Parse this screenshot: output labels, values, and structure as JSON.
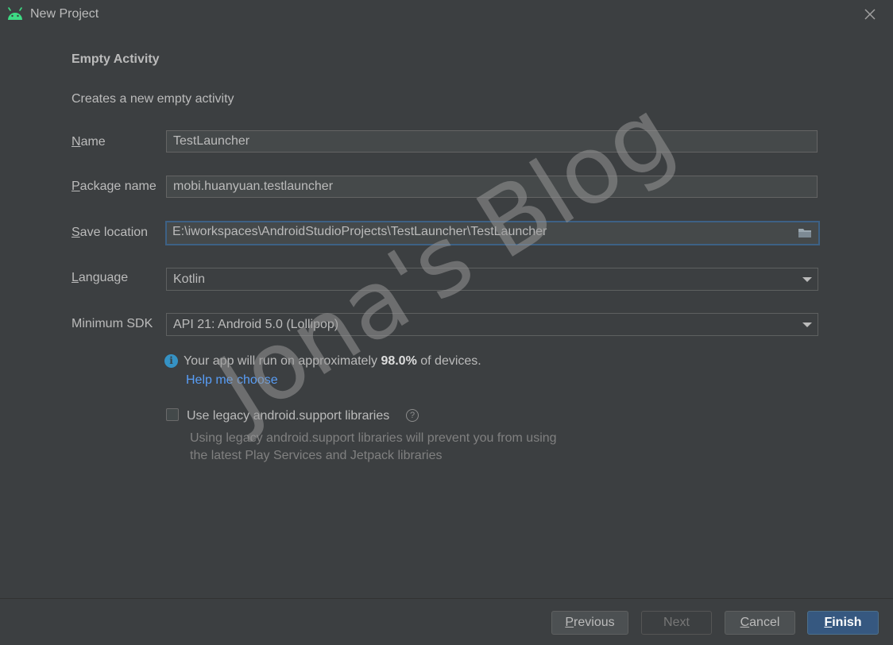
{
  "window": {
    "title": "New Project",
    "app_icon": "android-icon",
    "close_icon": "close-icon"
  },
  "template": {
    "heading": "Empty Activity",
    "description": "Creates a new empty activity"
  },
  "form": {
    "name": {
      "label_mnemonic": "N",
      "label_rest": "ame",
      "value": "TestLauncher"
    },
    "package": {
      "label_mnemonic": "P",
      "label_rest": "ackage name",
      "value": "mobi.huanyuan.testlauncher"
    },
    "location": {
      "label_mnemonic": "S",
      "label_rest": "ave location",
      "value": "E:\\iworkspaces\\AndroidStudioProjects\\TestLauncher\\TestLauncher",
      "browse_icon": "folder-icon"
    },
    "language": {
      "label_mnemonic": "L",
      "label_rest": "anguage",
      "value": "Kotlin"
    },
    "min_sdk": {
      "label": "Minimum SDK",
      "value": "API 21: Android 5.0 (Lollipop)"
    }
  },
  "info": {
    "icon": "info-icon",
    "text_before": "Your app will run on approximately ",
    "percent": "98.0%",
    "text_after": " of devices.",
    "help_link": "Help me choose"
  },
  "legacy": {
    "checked": false,
    "label": "Use legacy android.support libraries",
    "help_icon_glyph": "?",
    "note_line1": "Using legacy android.support libraries will prevent you from using",
    "note_line2": "the latest Play Services and Jetpack libraries"
  },
  "watermark": "Jona's Blog",
  "buttons": {
    "previous": {
      "mnemonic": "P",
      "rest": "revious"
    },
    "next": {
      "label": "Next"
    },
    "cancel": {
      "mnemonic": "C",
      "rest": "ancel"
    },
    "finish": {
      "mnemonic": "F",
      "rest": "inish"
    }
  },
  "colors": {
    "background": "#3c3f41",
    "accent_focus": "#3d6185",
    "primary_button": "#365880",
    "link": "#589df6",
    "info": "#3592c4"
  }
}
